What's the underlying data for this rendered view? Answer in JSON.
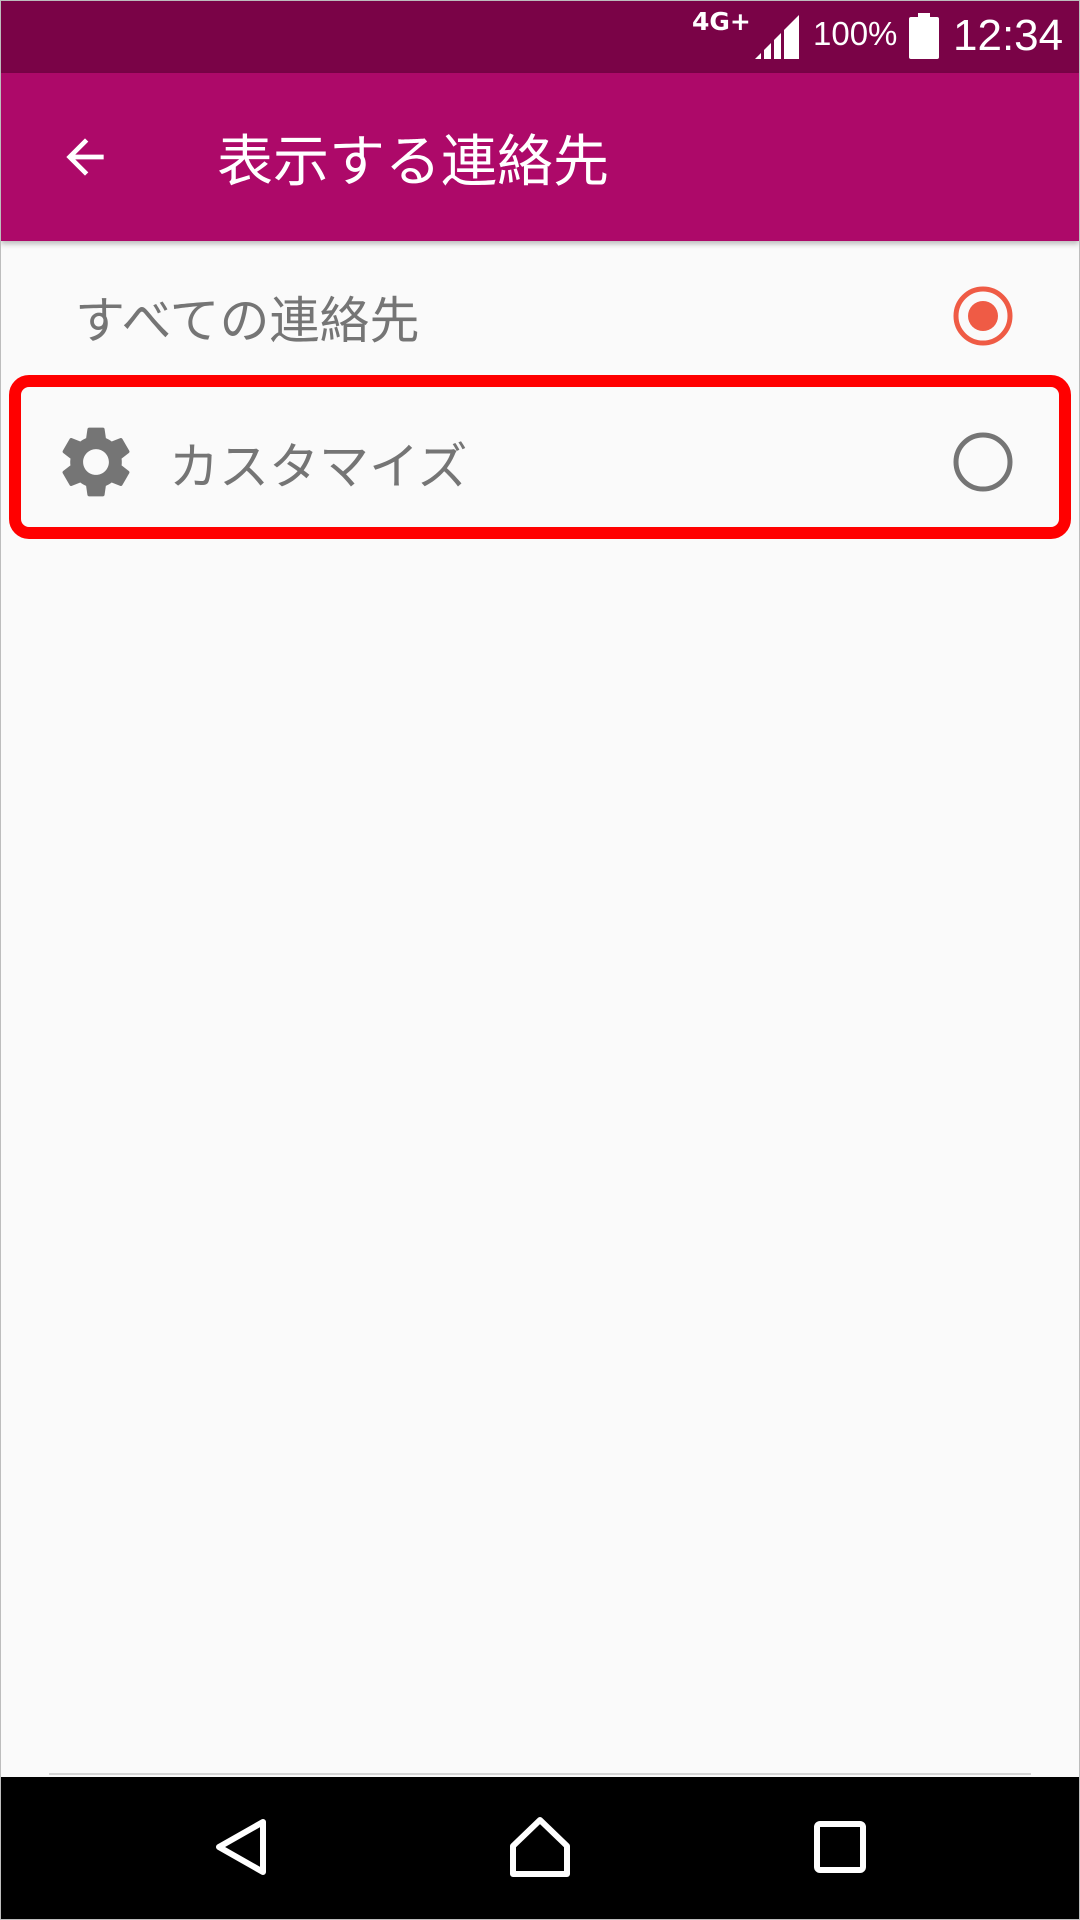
{
  "status_bar": {
    "network": "4G+",
    "battery": "100%",
    "time": "12:34"
  },
  "toolbar": {
    "title": "表示する連絡先"
  },
  "options": [
    {
      "label": "すべての連絡先",
      "selected": true
    },
    {
      "label": "カスタマイズ",
      "selected": false,
      "icon": "gear-icon"
    }
  ],
  "colors": {
    "status_bar": "#7a0347",
    "toolbar": "#ad0969",
    "radio_selected": "#ef5b45",
    "radio_unselected": "#757575",
    "highlight": "#ff0000"
  },
  "nav_bar": {
    "icons": [
      "back-triangle-icon",
      "home-icon",
      "recents-square-icon"
    ]
  }
}
